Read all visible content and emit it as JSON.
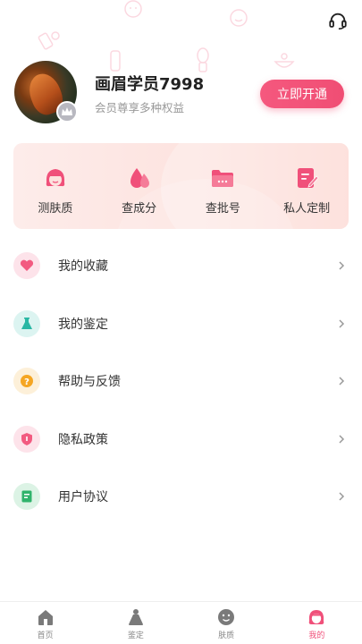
{
  "header": {
    "support_icon": "headset-icon"
  },
  "profile": {
    "username": "画眉学员7998",
    "subtitle": "会员尊享多种权益",
    "vip_button": "立即开通",
    "badge_icon": "crown-icon"
  },
  "features": [
    {
      "label": "测肤质",
      "icon": "face-icon"
    },
    {
      "label": "查成分",
      "icon": "drops-icon"
    },
    {
      "label": "查批号",
      "icon": "folder-icon"
    },
    {
      "label": "私人定制",
      "icon": "notepad-icon"
    }
  ],
  "menu": [
    {
      "label": "我的收藏",
      "icon": "heart-icon",
      "color": "#f25a80"
    },
    {
      "label": "我的鉴定",
      "icon": "flask-icon",
      "color": "#29b7a4"
    },
    {
      "label": "帮助与反馈",
      "icon": "question-icon",
      "color": "#f5a623"
    },
    {
      "label": "隐私政策",
      "icon": "shield-icon",
      "color": "#f25a80"
    },
    {
      "label": "用户协议",
      "icon": "document-icon",
      "color": "#2fb36b"
    }
  ],
  "nav": [
    {
      "label": "首页",
      "icon": "home-icon"
    },
    {
      "label": "鉴定",
      "icon": "bottle-icon"
    },
    {
      "label": "肤质",
      "icon": "face-icon"
    },
    {
      "label": "我的",
      "icon": "profile-icon",
      "active": true
    }
  ],
  "colors": {
    "accent": "#f0507a",
    "card_bg": "#fde2de"
  }
}
